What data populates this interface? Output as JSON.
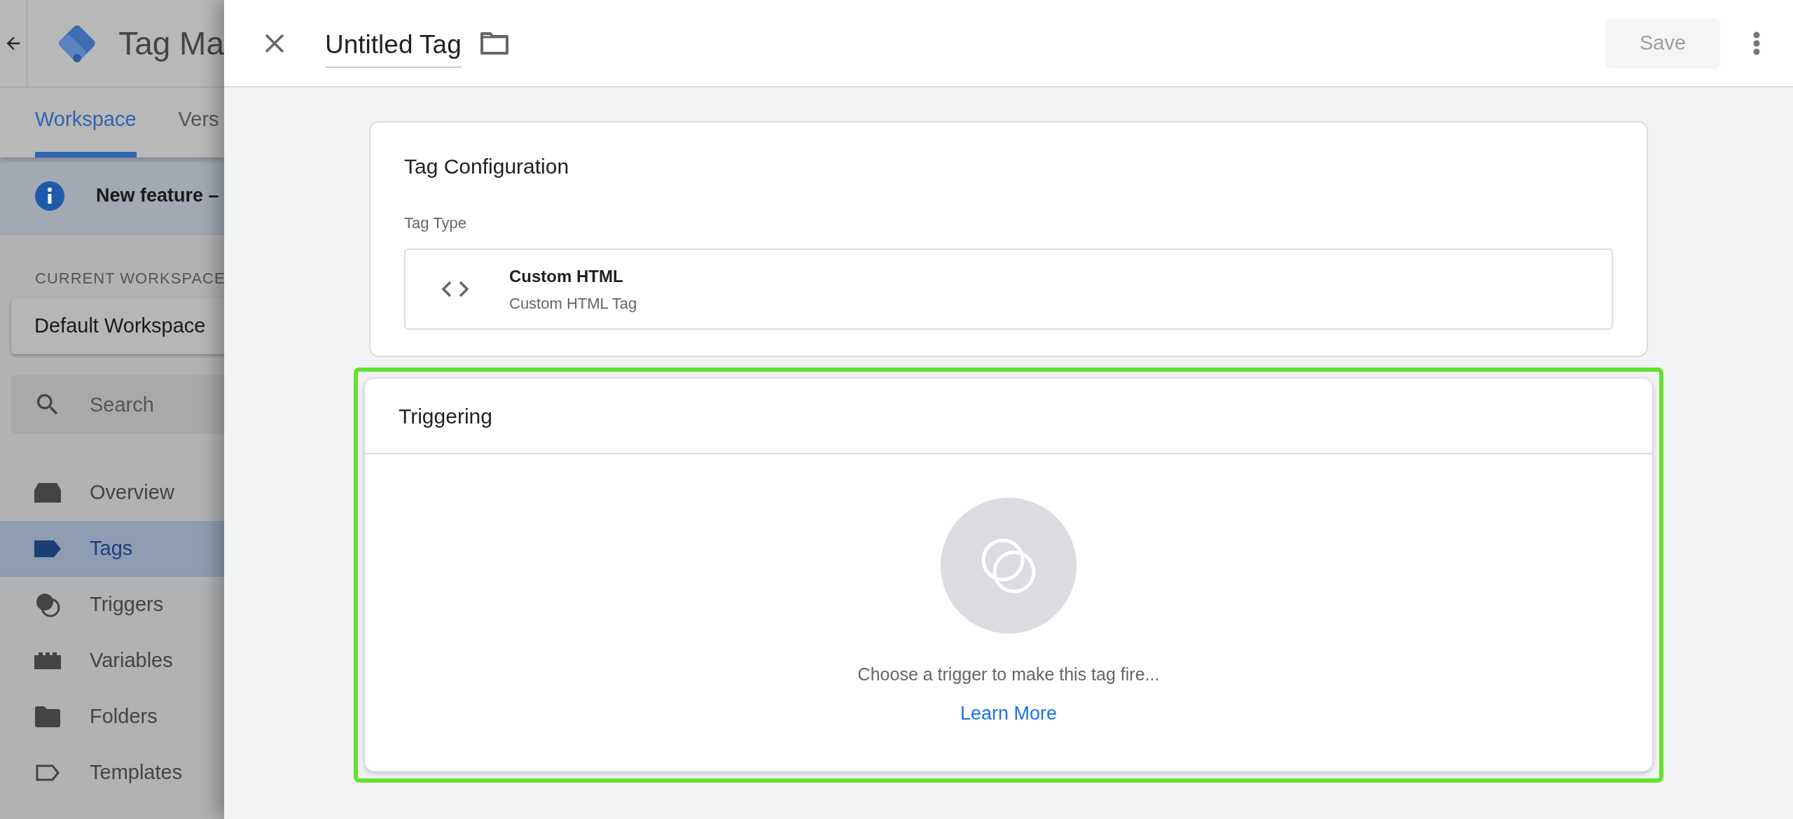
{
  "backdrop": {
    "app_title": "Tag Ma",
    "tabs": [
      {
        "label": "Workspace",
        "selected": true
      },
      {
        "label": "Vers",
        "selected": false
      }
    ],
    "banner": "New feature –",
    "workspace_label": "CURRENT WORKSPACE",
    "workspace": "Default Workspace",
    "search": {
      "placeholder": "Search"
    },
    "nav": [
      {
        "label": "Overview",
        "selected": false
      },
      {
        "label": "Tags",
        "selected": true
      },
      {
        "label": "Triggers",
        "selected": false
      },
      {
        "label": "Variables",
        "selected": false
      },
      {
        "label": "Folders",
        "selected": false
      },
      {
        "label": "Templates",
        "selected": false
      }
    ]
  },
  "editor": {
    "title": "Untitled Tag",
    "save": {
      "label": "Save",
      "disabled": true
    },
    "config": {
      "title": "Tag Configuration",
      "type_label": "Tag Type",
      "type_name": "Custom HTML",
      "type_desc": "Custom HTML Tag"
    },
    "triggering": {
      "title": "Triggering",
      "highlighted": true,
      "message": "Choose a trigger to make this tag fire...",
      "link": "Learn More"
    }
  }
}
